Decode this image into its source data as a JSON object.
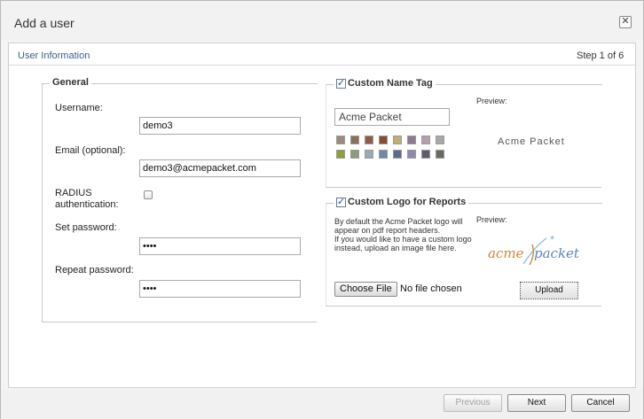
{
  "dialog": {
    "title": "Add a user",
    "close_glyph": "✕",
    "section_title": "User Information",
    "step": "Step 1 of 6"
  },
  "general": {
    "legend": "General",
    "username_label": "Username:",
    "username_value": "demo3",
    "email_label": "Email (optional):",
    "email_value": "demo3@acmepacket.com",
    "radius_label_1": "RADIUS",
    "radius_label_2": "authentication:",
    "radius_checked": false,
    "password_label": "Set password:",
    "password_value": "••••",
    "repeat_label": "Repeat password:",
    "repeat_value": "••••"
  },
  "name_tag": {
    "legend": "Custom Name Tag",
    "checked": true,
    "input_value": "Acme Packet",
    "preview_label": "Preview:",
    "preview_text": "Acme Packet",
    "swatches": [
      "#9b8a7d",
      "#8a6f5a",
      "#8e5a4b",
      "#8d4a2e",
      "#c2ad72",
      "#8e7a93",
      "#b69eb0",
      "#a9a8a5",
      "#8e9d3f",
      "#8a9a7d",
      "#9aabae",
      "#6f8aa8",
      "#5f6b8c",
      "#8f89b0",
      "#5e5d6f",
      "#666a60"
    ]
  },
  "logo": {
    "legend": "Custom Logo for Reports",
    "checked": true,
    "desc_1": "By default the Acme Packet logo will appear on pdf report headers.",
    "desc_2": "If you would like to have a custom logo instead, upload an image file here.",
    "preview_label": "Preview:",
    "logo_text_left": "acme",
    "logo_text_right": "packet",
    "choose_file_label": "Choose File",
    "file_status": "No file chosen",
    "upload_label": "Upload"
  },
  "footer": {
    "previous_label": "Previous",
    "next_label": "Next",
    "cancel_label": "Cancel"
  }
}
